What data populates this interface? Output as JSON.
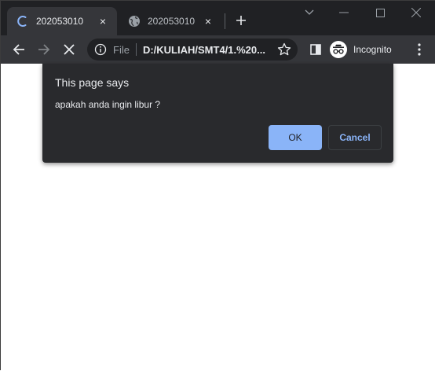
{
  "tabs": [
    {
      "title": "202053010",
      "state": "loading",
      "close": "×"
    },
    {
      "title": "202053010",
      "state": "idle",
      "close": "×"
    }
  ],
  "new_tab_label": "+",
  "toolbar": {
    "scheme": "File",
    "url": "D:/KULIAH/SMT4/1.%20...",
    "profile_label": "Incognito"
  },
  "dialog": {
    "heading": "This page says",
    "message": "apakah anda ingin libur ?",
    "ok_label": "OK",
    "cancel_label": "Cancel"
  },
  "colors": {
    "tabstrip": "#202124",
    "toolbar": "#35363a",
    "dialog": "#292a2d",
    "accent": "#8ab4f8",
    "text": "#e8eaed"
  },
  "icons": [
    "loading-spinner-icon",
    "globe-icon",
    "close-icon",
    "plus-icon",
    "chevron-down-icon",
    "minimize-icon",
    "maximize-icon",
    "window-close-icon",
    "back-arrow-icon",
    "forward-arrow-icon",
    "stop-icon",
    "info-icon",
    "star-icon",
    "side-panel-icon",
    "incognito-icon",
    "more-vert-icon"
  ]
}
